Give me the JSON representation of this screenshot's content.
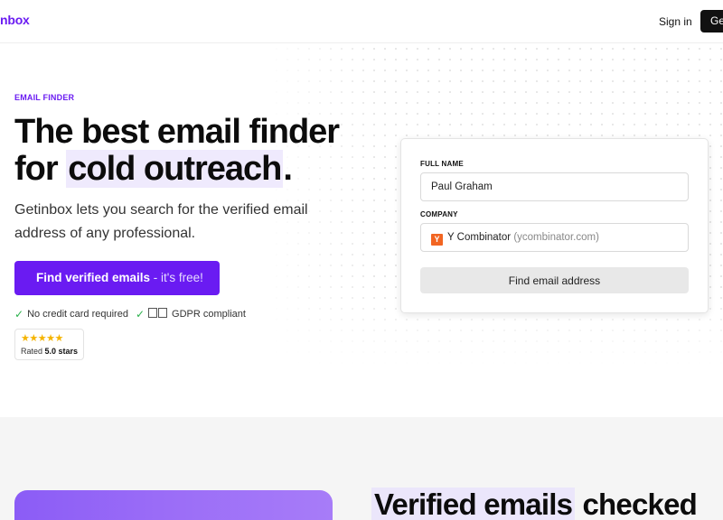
{
  "header": {
    "logo": "nbox",
    "signin": "Sign in",
    "get_started": "Ge"
  },
  "hero": {
    "eyebrow": "EMAIL FINDER",
    "headline_line1": "The best email finder",
    "headline_for": "for ",
    "headline_highlight": "cold outreach",
    "headline_period": ".",
    "subtitle": "Getinbox lets you search for the verified email address of any professional.",
    "cta_main": "Find verified emails",
    "cta_free": " - it's free!",
    "trust": [
      {
        "label": "No credit card required"
      },
      {
        "label": "GDPR compliant"
      }
    ],
    "rating_stars": "★★★★★",
    "rating_prefix": "Rated ",
    "rating_value": "5.0 stars"
  },
  "form": {
    "full_name_label": "FULL NAME",
    "full_name_value": "Paul Graham",
    "company_label": "COMPANY",
    "company_icon": "Y",
    "company_name": "Y Combinator",
    "company_domain": "(ycombinator.com)",
    "submit_label": "Find email address"
  },
  "lower": {
    "title_highlight": "Verified emails",
    "title_rest": " checked"
  },
  "colors": {
    "brand": "#6a1bf2",
    "check": "#2bb24c",
    "star": "#f5b400",
    "yc": "#f26522"
  }
}
